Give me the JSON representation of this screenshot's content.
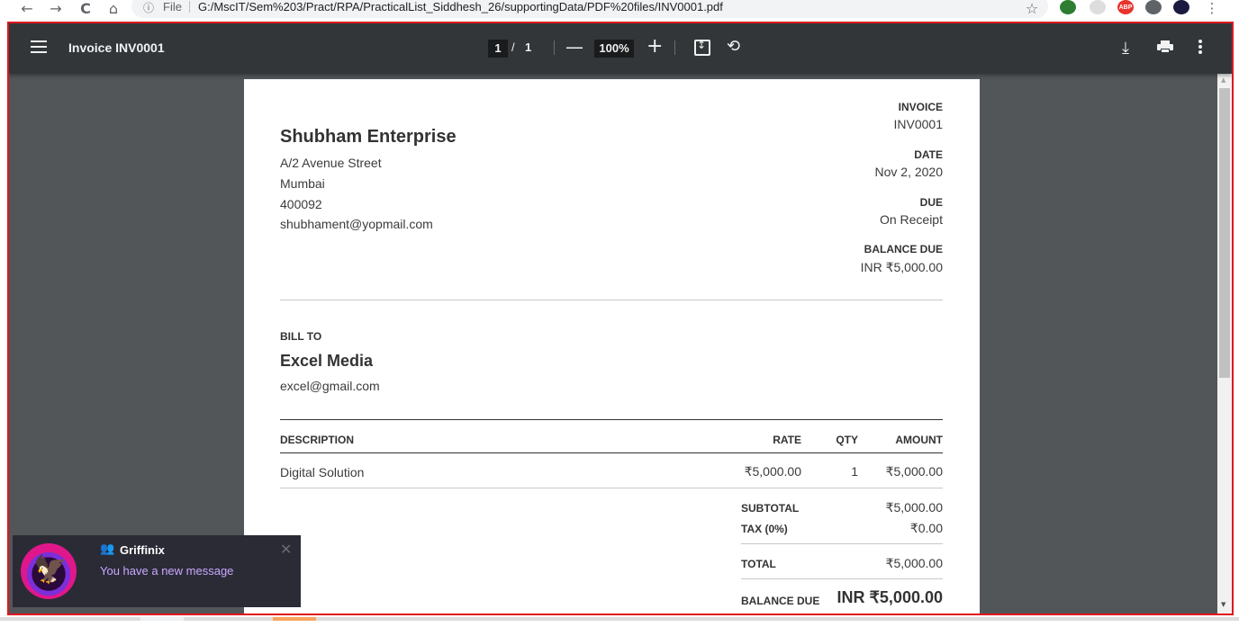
{
  "browser": {
    "nav": {
      "back": "←",
      "forward": "→",
      "reload": "C",
      "home": "⌂"
    },
    "omnibox": {
      "info_icon": "ⓘ",
      "scheme_label": "File",
      "url": "G:/MscIT/Sem%203/Pract/RPA/PracticalList_Siddhesh_26/supportingData/PDF%20files/INV0001.pdf"
    },
    "star_icon": "☆",
    "extensions": [
      {
        "name": "green-extension-icon",
        "color": "#2e7d32",
        "text": ""
      },
      {
        "name": "blank-extension-icon",
        "color": "#dddddd",
        "text": ""
      },
      {
        "name": "adblock-extension-icon",
        "color": "#e8332c",
        "text": "ABP"
      },
      {
        "name": "puzzle-extension-icon",
        "color": "#5f6368",
        "text": ""
      },
      {
        "name": "profile-avatar-icon",
        "color": "#1a1a40",
        "text": ""
      }
    ],
    "menu_icon": "⋮"
  },
  "viewer": {
    "title": "Invoice INV0001",
    "page_current": "1",
    "page_separator": "/",
    "page_total": "1",
    "zoom_out": "—",
    "zoom": "100%",
    "zoom_in": "+",
    "rotate_icon": "⟲",
    "download_icon": "⤓"
  },
  "invoice": {
    "company": {
      "name": "Shubham Enterprise",
      "address_line1": "A/2 Avenue Street",
      "city": "Mumbai",
      "postal": "400092",
      "email": "shubhament@yopmail.com"
    },
    "meta": {
      "invoice_label": "INVOICE",
      "invoice_value": "INV0001",
      "date_label": "DATE",
      "date_value": "Nov 2, 2020",
      "due_label": "DUE",
      "due_value": "On Receipt",
      "balance_label": "BALANCE DUE",
      "balance_value": "INR ₹5,000.00"
    },
    "bill_to": {
      "label": "BILL TO",
      "name": "Excel Media",
      "email": "excel@gmail.com"
    },
    "table": {
      "headers": {
        "description": "DESCRIPTION",
        "rate": "RATE",
        "qty": "QTY",
        "amount": "AMOUNT"
      },
      "rows": [
        {
          "description": "Digital Solution",
          "rate": "₹5,000.00",
          "qty": "1",
          "amount": "₹5,000.00"
        }
      ]
    },
    "totals": {
      "subtotal_label": "SUBTOTAL",
      "subtotal_value": "₹5,000.00",
      "tax_label": "TAX (0%)",
      "tax_value": "₹0.00",
      "total_label": "TOTAL",
      "total_value": "₹5,000.00",
      "balance_label": "BALANCE DUE",
      "balance_value": "INR ₹5,000.00"
    }
  },
  "toast": {
    "users_icon": "👥",
    "title": "Griffinix",
    "message": "You have a new message",
    "close": "✕"
  },
  "taskbar": {
    "clock": ""
  }
}
